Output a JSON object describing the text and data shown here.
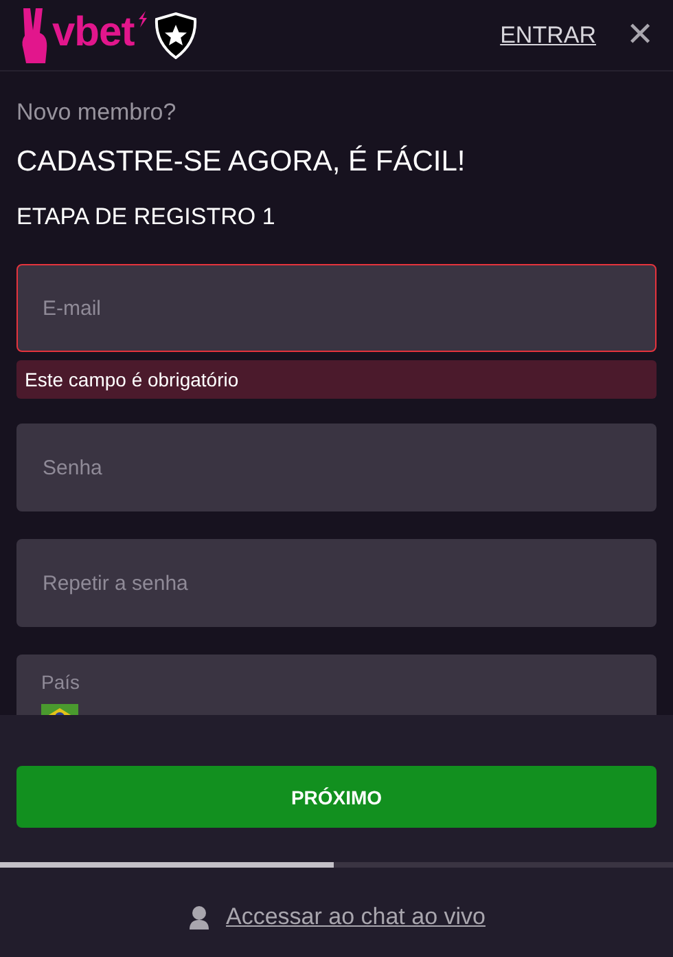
{
  "header": {
    "logo": "vbet",
    "login_link": "ENTRAR",
    "close": "✕"
  },
  "intro": {
    "question": "Novo membro?",
    "headline": "CADASTRE-SE AGORA, É FÁCIL!",
    "step": "ETAPA DE REGISTRO 1"
  },
  "fields": [
    {
      "kind": "input",
      "placeholder": "E-mail",
      "invalid": true,
      "error": "Este campo é obrigatório"
    },
    {
      "kind": "input",
      "placeholder": "Senha",
      "invalid": false
    },
    {
      "kind": "input",
      "placeholder": "Repetir a senha",
      "invalid": false
    },
    {
      "kind": "select",
      "label": "País"
    }
  ],
  "next_button": "PRÓXIMO",
  "progress": {
    "level": 0.495
  },
  "chat_link": "Accessar ao chat ao vivo"
}
